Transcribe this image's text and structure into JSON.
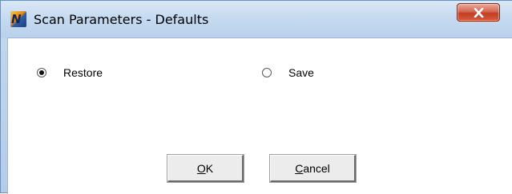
{
  "window": {
    "title": "Scan Parameters - Defaults",
    "app_icon": "app-logo-icon",
    "close_icon": "close-icon"
  },
  "options": {
    "restore": {
      "label": "Restore",
      "checked": true
    },
    "save": {
      "label": "Save",
      "checked": false
    }
  },
  "buttons": {
    "ok": {
      "mnemonic": "O",
      "rest": "K"
    },
    "cancel": {
      "mnemonic": "C",
      "rest": "ancel"
    }
  }
}
